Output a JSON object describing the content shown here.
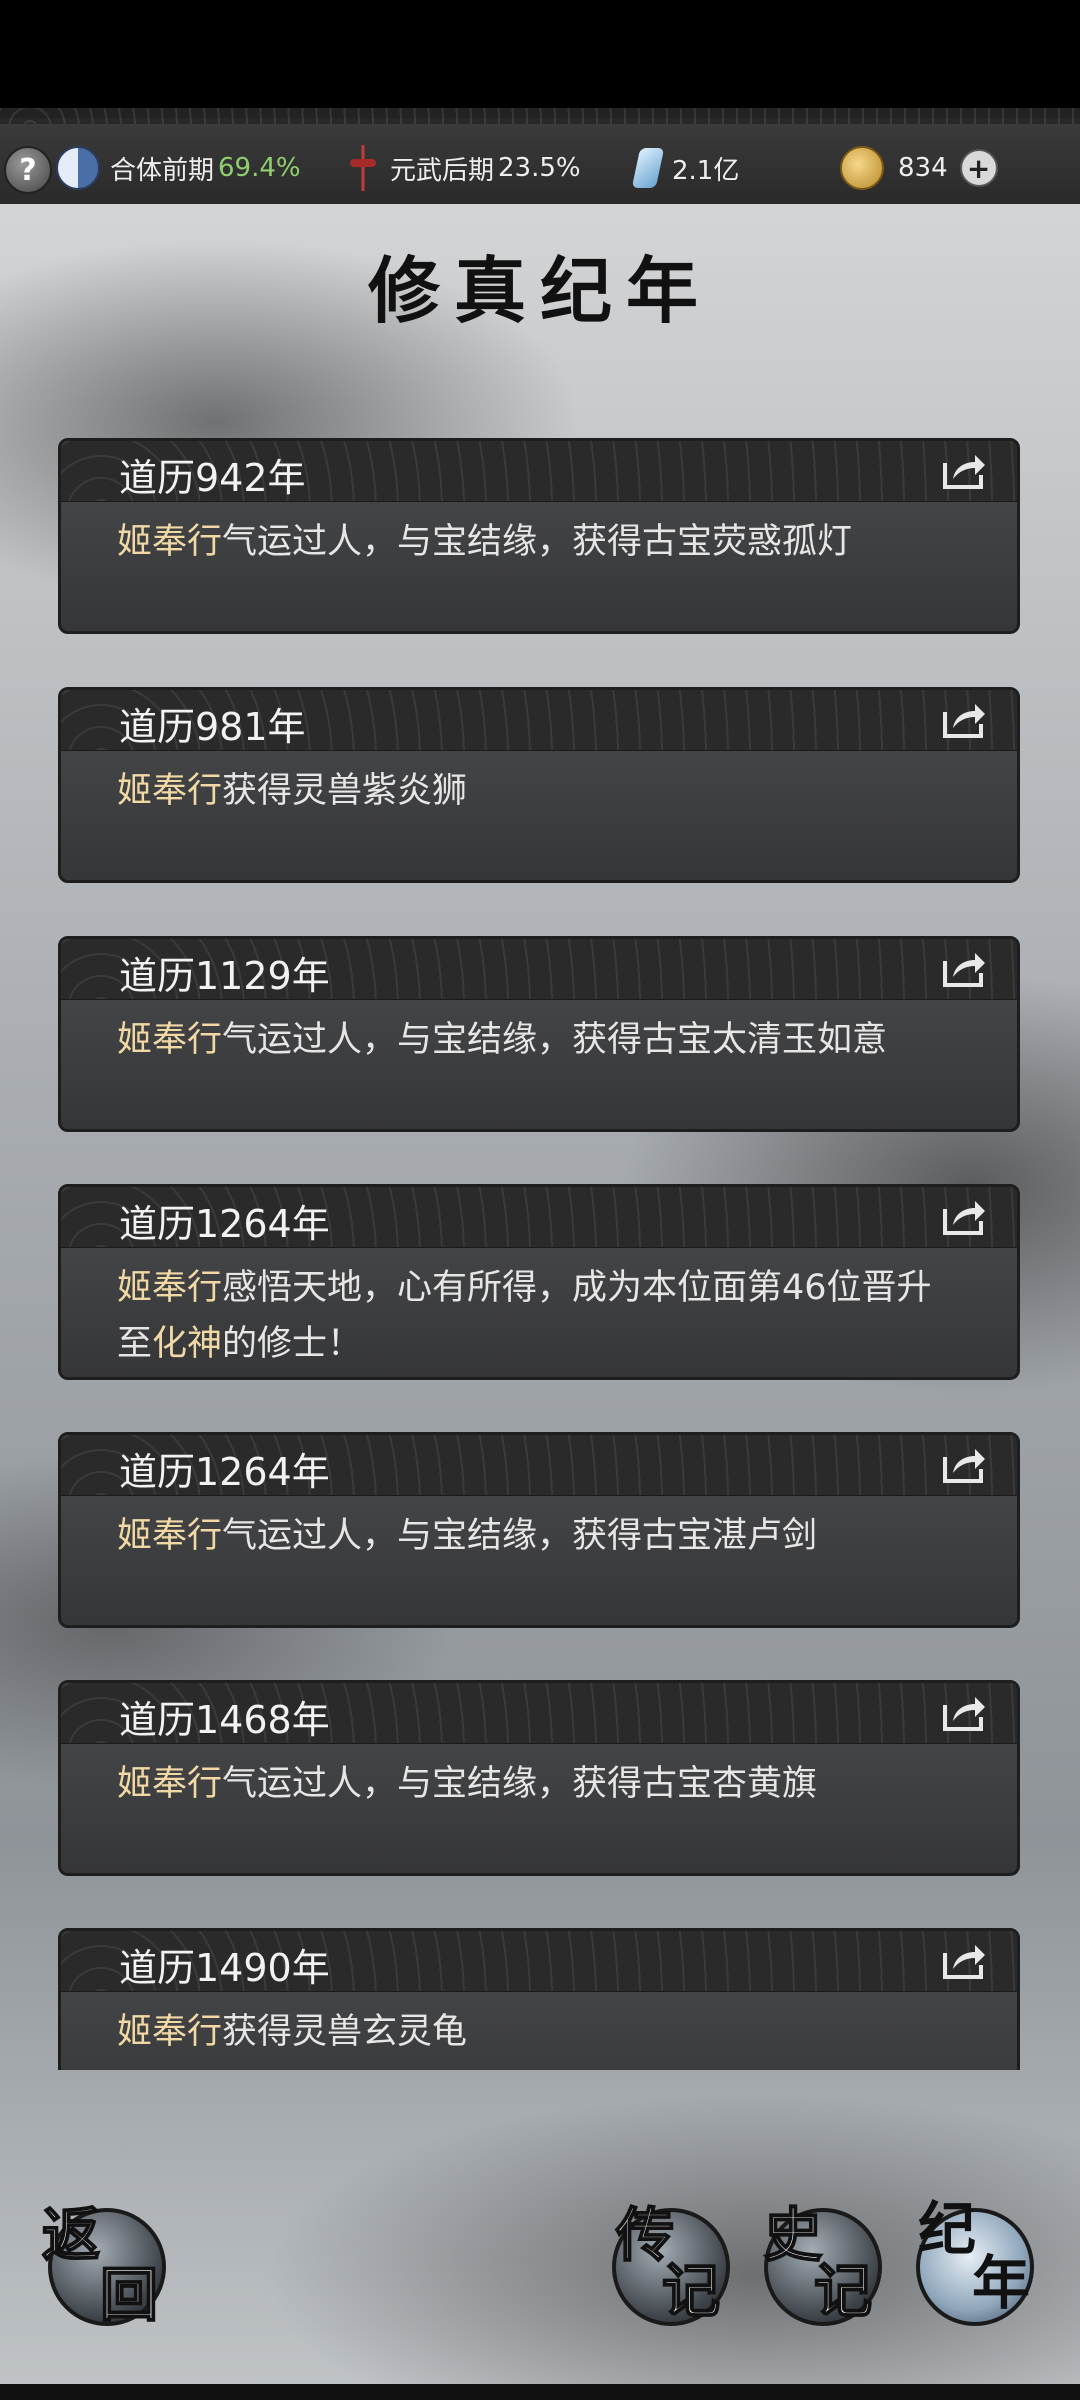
{
  "topbar": {
    "help": "?",
    "cultivation": {
      "label": "合体前期",
      "percent": "69.4%"
    },
    "martial": {
      "label": "元武后期",
      "percent": "23.5%"
    },
    "spirit_stones": "2.1亿",
    "gold": "834",
    "plus": "+"
  },
  "page": {
    "title": "修真纪年"
  },
  "events": [
    {
      "year": "道历942年",
      "name": "姬奉行",
      "text": "气运过人，与宝结缘，获得古宝荧惑孤灯"
    },
    {
      "year": "道历981年",
      "name": "姬奉行",
      "text": "获得灵兽紫炎狮"
    },
    {
      "year": "道历1129年",
      "name": "姬奉行",
      "text": "气运过人，与宝结缘，获得古宝太清玉如意"
    },
    {
      "year": "道历1264年",
      "name": "姬奉行",
      "text": "感悟天地，心有所得，成为本位面第46位晋升至",
      "highlight": "化神",
      "text_end": "的修士！"
    },
    {
      "year": "道历1264年",
      "name": "姬奉行",
      "text": "气运过人，与宝结缘，获得古宝湛卢剑"
    },
    {
      "year": "道历1468年",
      "name": "姬奉行",
      "text": "气运过人，与宝结缘，获得古宝杏黄旗"
    },
    {
      "year": "道历1490年",
      "name": "姬奉行",
      "text": "获得灵兽玄灵龟"
    }
  ],
  "nav": {
    "back": [
      "返",
      "回"
    ],
    "biography": [
      "传",
      "记"
    ],
    "history": [
      "史",
      "记"
    ],
    "chronicle": [
      "纪",
      "年"
    ]
  }
}
